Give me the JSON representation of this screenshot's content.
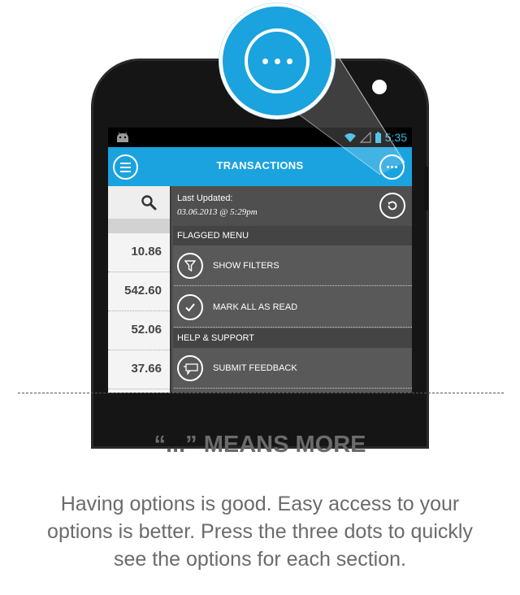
{
  "status_bar": {
    "time": "5:35"
  },
  "app_bar": {
    "title": "TRANSACTIONS"
  },
  "list": {
    "values": [
      "10.86",
      "542.60",
      "52.06",
      "37.66"
    ]
  },
  "menu": {
    "last_updated_label": "Last Updated:",
    "last_updated_value": "03.06.2013 @ 5:29pm",
    "sections": [
      {
        "title": "FLAGGED MENU",
        "items": [
          "SHOW FILTERS",
          "MARK ALL AS READ"
        ]
      },
      {
        "title": "HELP & SUPPORT",
        "items": [
          "SUBMIT FEEDBACK"
        ]
      }
    ]
  },
  "caption": {
    "heading": "“...” MEANS MORE",
    "body": "Having options is good. Easy access to your options is better. Press the three dots to quickly see the options for each section."
  },
  "colors": {
    "accent": "#1aa3de",
    "menu_bg": "#595959",
    "section_bg": "#444444",
    "text": "#6b6b6b"
  },
  "icons": [
    "android-icon",
    "wifi-icon",
    "signal-icon",
    "battery-icon",
    "hamburger-menu-icon",
    "more-dots-icon",
    "search-icon",
    "refresh-icon",
    "filter-icon",
    "checkmark-icon",
    "feedback-icon"
  ]
}
